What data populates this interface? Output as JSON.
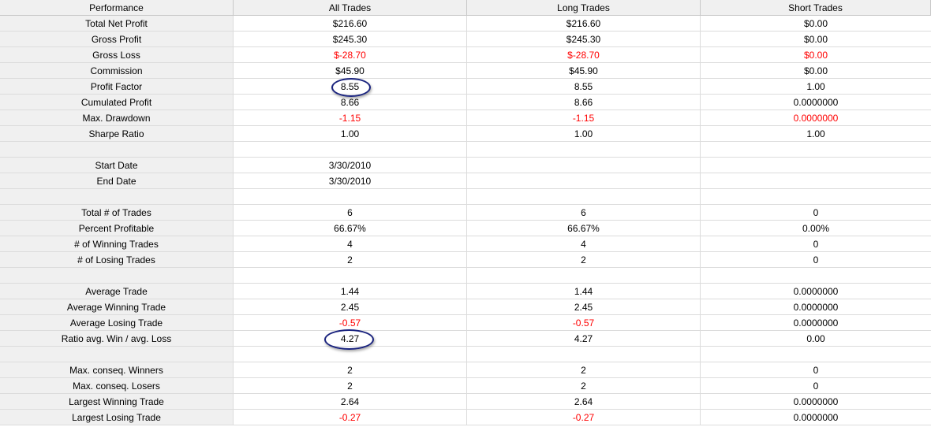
{
  "headers": [
    "Performance",
    "All Trades",
    "Long Trades",
    "Short Trades"
  ],
  "rows": [
    {
      "label": "Total Net Profit",
      "all": "$216.60",
      "long": "$216.60",
      "short": "$0.00",
      "neg": [
        false,
        false,
        false
      ]
    },
    {
      "label": "Gross Profit",
      "all": "$245.30",
      "long": "$245.30",
      "short": "$0.00",
      "neg": [
        false,
        false,
        false
      ]
    },
    {
      "label": "Gross Loss",
      "all": "$-28.70",
      "long": "$-28.70",
      "short": "$0.00",
      "neg": [
        true,
        true,
        true
      ]
    },
    {
      "label": "Commission",
      "all": "$45.90",
      "long": "$45.90",
      "short": "$0.00",
      "neg": [
        false,
        false,
        false
      ]
    },
    {
      "label": "Profit Factor",
      "all": "8.55",
      "long": "8.55",
      "short": "1.00",
      "neg": [
        false,
        false,
        false
      ]
    },
    {
      "label": "Cumulated Profit",
      "all": "8.66",
      "long": "8.66",
      "short": "0.0000000",
      "neg": [
        false,
        false,
        false
      ]
    },
    {
      "label": "Max. Drawdown",
      "all": "-1.15",
      "long": "-1.15",
      "short": "0.0000000",
      "neg": [
        true,
        true,
        true
      ]
    },
    {
      "label": "Sharpe Ratio",
      "all": "1.00",
      "long": "1.00",
      "short": "1.00",
      "neg": [
        false,
        false,
        false
      ]
    },
    {
      "label": "",
      "all": "",
      "long": "",
      "short": "",
      "neg": [
        false,
        false,
        false
      ]
    },
    {
      "label": "Start Date",
      "all": "3/30/2010",
      "long": "",
      "short": "",
      "neg": [
        false,
        false,
        false
      ]
    },
    {
      "label": "End Date",
      "all": "3/30/2010",
      "long": "",
      "short": "",
      "neg": [
        false,
        false,
        false
      ]
    },
    {
      "label": "",
      "all": "",
      "long": "",
      "short": "",
      "neg": [
        false,
        false,
        false
      ]
    },
    {
      "label": "Total # of Trades",
      "all": "6",
      "long": "6",
      "short": "0",
      "neg": [
        false,
        false,
        false
      ]
    },
    {
      "label": "Percent Profitable",
      "all": "66.67%",
      "long": "66.67%",
      "short": "0.00%",
      "neg": [
        false,
        false,
        false
      ]
    },
    {
      "label": "# of Winning Trades",
      "all": "4",
      "long": "4",
      "short": "0",
      "neg": [
        false,
        false,
        false
      ]
    },
    {
      "label": "# of Losing Trades",
      "all": "2",
      "long": "2",
      "short": "0",
      "neg": [
        false,
        false,
        false
      ]
    },
    {
      "label": "",
      "all": "",
      "long": "",
      "short": "",
      "neg": [
        false,
        false,
        false
      ]
    },
    {
      "label": "Average Trade",
      "all": "1.44",
      "long": "1.44",
      "short": "0.0000000",
      "neg": [
        false,
        false,
        false
      ]
    },
    {
      "label": "Average Winning Trade",
      "all": "2.45",
      "long": "2.45",
      "short": "0.0000000",
      "neg": [
        false,
        false,
        false
      ]
    },
    {
      "label": "Average Losing Trade",
      "all": "-0.57",
      "long": "-0.57",
      "short": "0.0000000",
      "neg": [
        true,
        true,
        false
      ]
    },
    {
      "label": "Ratio avg. Win / avg. Loss",
      "all": "4.27",
      "long": "4.27",
      "short": "0.00",
      "neg": [
        false,
        false,
        false
      ]
    },
    {
      "label": "",
      "all": "",
      "long": "",
      "short": "",
      "neg": [
        false,
        false,
        false
      ]
    },
    {
      "label": "Max. conseq. Winners",
      "all": "2",
      "long": "2",
      "short": "0",
      "neg": [
        false,
        false,
        false
      ]
    },
    {
      "label": "Max. conseq. Losers",
      "all": "2",
      "long": "2",
      "short": "0",
      "neg": [
        false,
        false,
        false
      ]
    },
    {
      "label": "Largest Winning Trade",
      "all": "2.64",
      "long": "2.64",
      "short": "0.0000000",
      "neg": [
        false,
        false,
        false
      ]
    },
    {
      "label": "Largest Losing Trade",
      "all": "-0.27",
      "long": "-0.27",
      "short": "0.0000000",
      "neg": [
        true,
        true,
        false
      ]
    }
  ],
  "colors": {
    "negative": "#ff0000",
    "annotation": "#1a237e",
    "header_bg": "#f0f0f0"
  }
}
